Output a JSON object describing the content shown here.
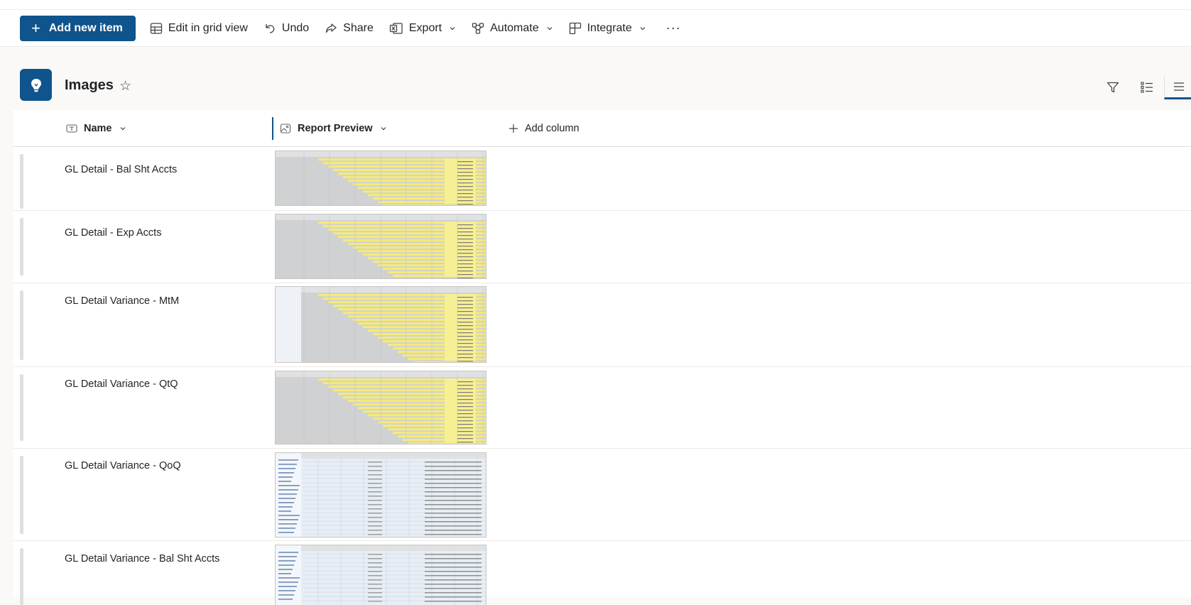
{
  "commandbar": {
    "add_new_item": "Add new item",
    "edit_grid": "Edit in grid view",
    "undo": "Undo",
    "share": "Share",
    "export": "Export",
    "automate": "Automate",
    "integrate": "Integrate",
    "more": "···"
  },
  "list": {
    "title": "Images",
    "icon": "lightbulb-icon",
    "accent_color": "#0f548c"
  },
  "columns": {
    "name": "Name",
    "report_preview": "Report Preview",
    "add_column": "Add column"
  },
  "rows": [
    {
      "name": "GL Detail - Bal Sht Accts"
    },
    {
      "name": "GL Detail - Exp Accts"
    },
    {
      "name": "GL Detail Variance - MtM"
    },
    {
      "name": "GL Detail Variance - QtQ"
    },
    {
      "name": "GL Detail Variance - QoQ"
    },
    {
      "name": "GL Detail Variance - Bal Sht Accts"
    }
  ]
}
